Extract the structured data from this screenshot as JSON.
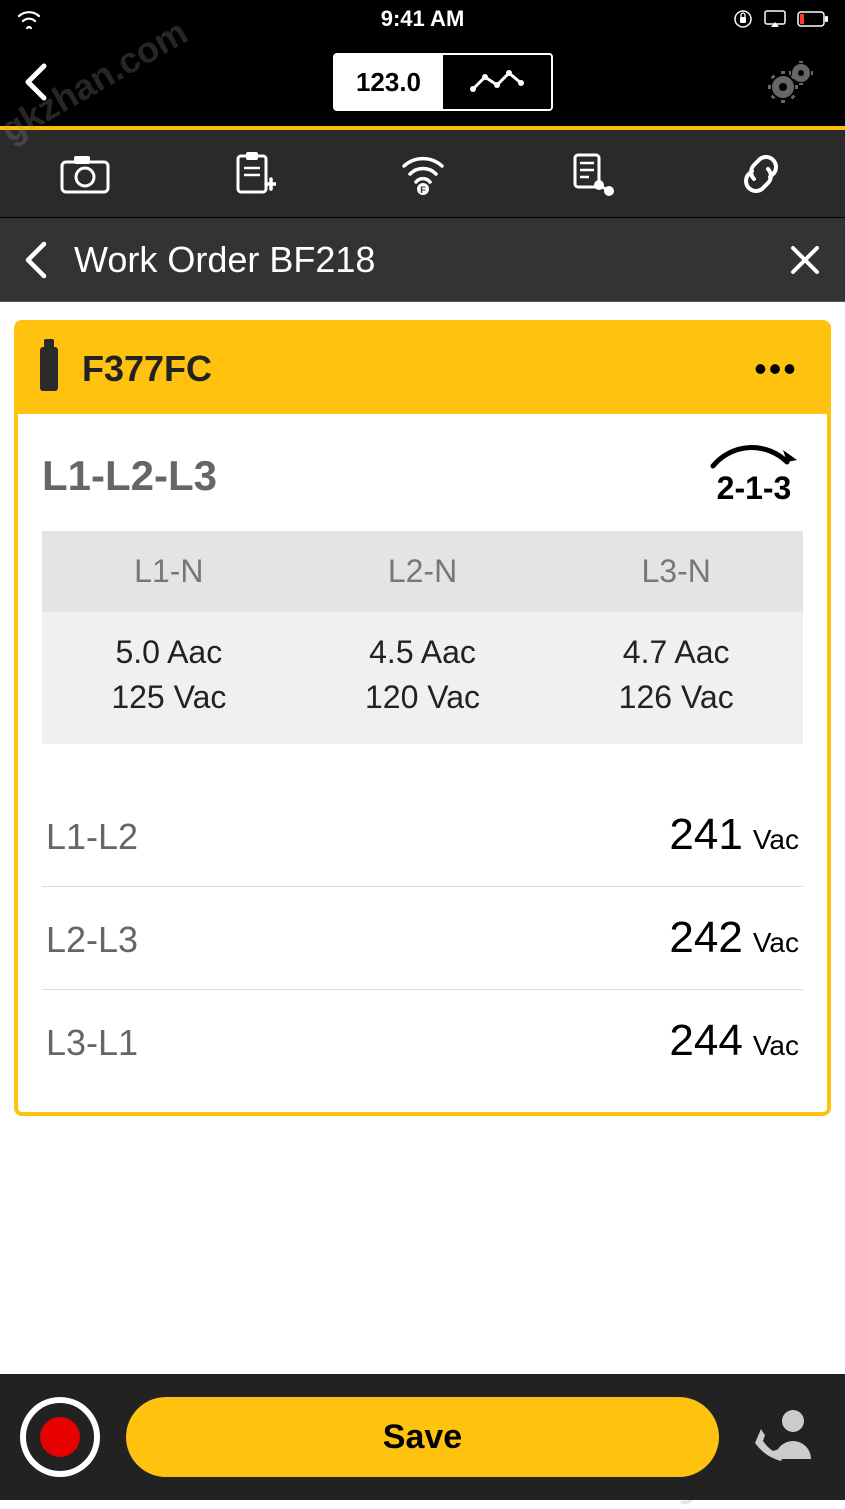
{
  "statusbar": {
    "time": "9:41 AM"
  },
  "topnav": {
    "view_toggle_number": "123.0"
  },
  "workorder": {
    "title": "Work Order BF218"
  },
  "device": {
    "name": "F377FC"
  },
  "section": {
    "title": "L1-L2-L3",
    "rotation": "2-1-3"
  },
  "phase_headers": [
    "L1-N",
    "L2-N",
    "L3-N"
  ],
  "phase_amps": [
    "5.0 Aac",
    "4.5 Aac",
    "4.7 Aac"
  ],
  "phase_volts": [
    "125 Vac",
    "120 Vac",
    "126 Vac"
  ],
  "line_to_line": [
    {
      "label": "L1-L2",
      "value": "241",
      "unit": "Vac"
    },
    {
      "label": "L2-L3",
      "value": "242",
      "unit": "Vac"
    },
    {
      "label": "L3-L1",
      "value": "244",
      "unit": "Vac"
    }
  ],
  "footer": {
    "save_label": "Save"
  },
  "watermark": "gkzhan.com"
}
